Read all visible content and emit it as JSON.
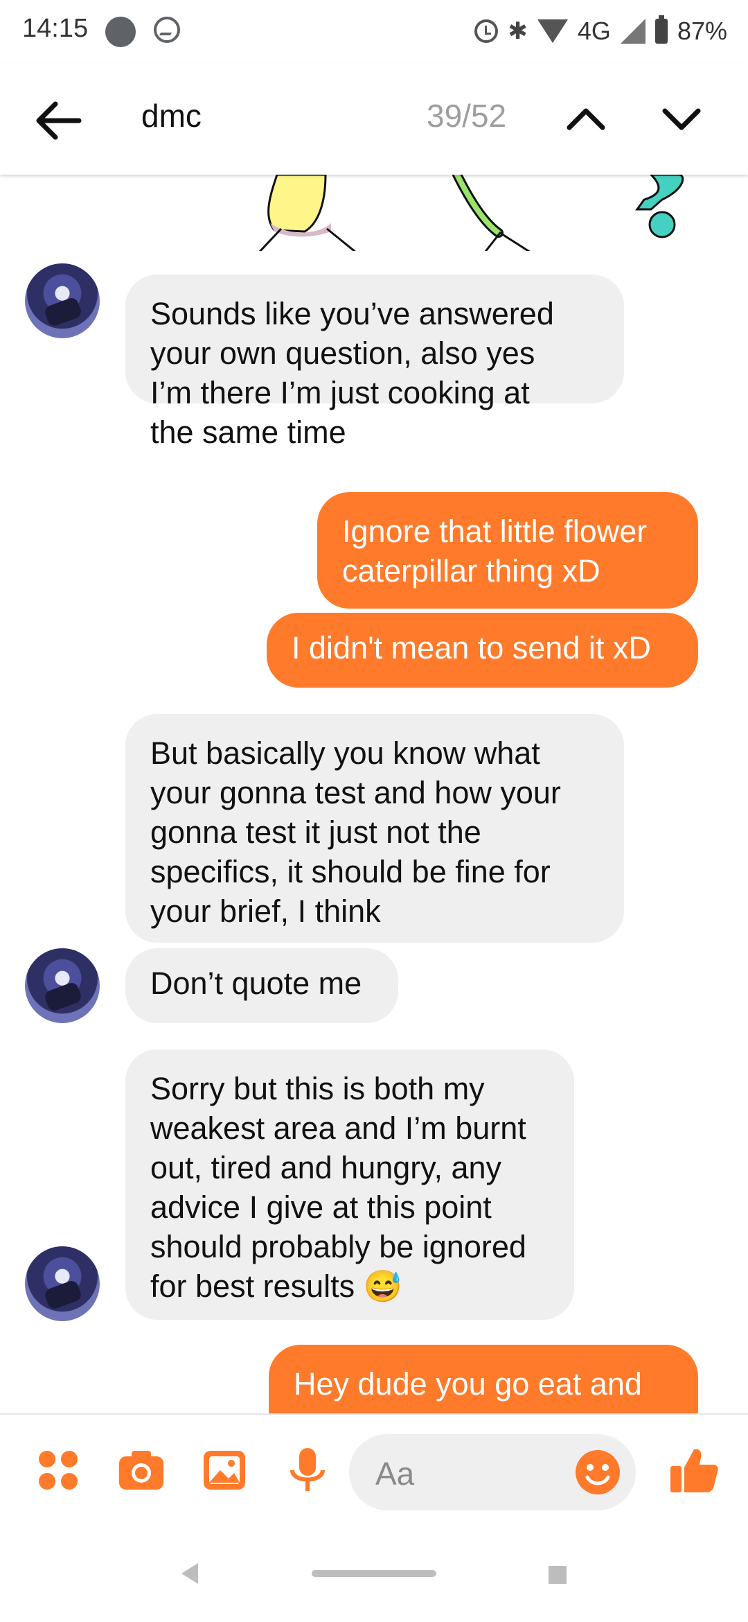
{
  "status_bar": {
    "time": "14:15",
    "network": "4G",
    "battery": "87%"
  },
  "search": {
    "query": "dmc",
    "counter": "39/52"
  },
  "messages": [
    {
      "from": "them",
      "lines": [
        "Sounds like you’ve answered",
        "your own question, also yes",
        "I’m there I’m just cooking at",
        "the same time"
      ]
    },
    {
      "from": "me",
      "lines": [
        "Ignore that little flower",
        "caterpillar thing xD"
      ]
    },
    {
      "from": "me",
      "lines": [
        "I didn't mean to send it xD"
      ]
    },
    {
      "from": "them",
      "lines": [
        "But basically you know what",
        "your gonna test and how your",
        "gonna test it just not the",
        "specifics, it should be fine for",
        "your brief, I think"
      ]
    },
    {
      "from": "them",
      "lines": [
        "Don’t quote me"
      ]
    },
    {
      "from": "them",
      "lines": [
        "Sorry but this is both my",
        "weakest area and I’m burnt",
        "out, tired and hungry, any",
        "advice I give at this point",
        "should probably be ignored",
        "for best results 😅"
      ]
    },
    {
      "from": "me",
      "lines": [
        "Hey dude you go eat and"
      ]
    }
  ],
  "composer": {
    "placeholder": "Aa"
  },
  "colors": {
    "accent": "#ff7a2a",
    "incoming_bubble": "#efefef"
  }
}
